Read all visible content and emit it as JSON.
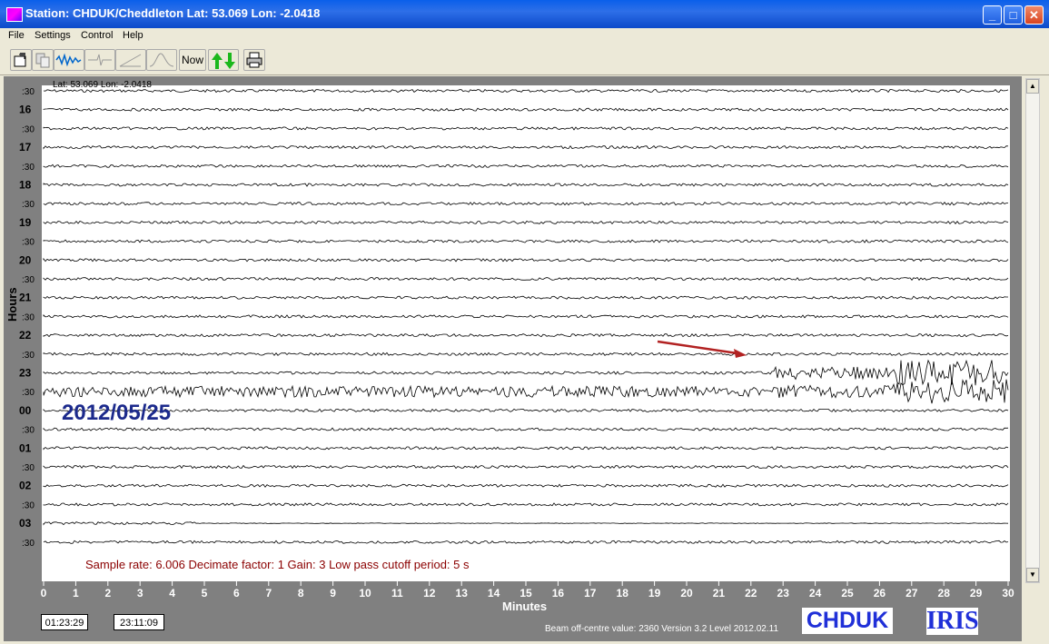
{
  "window": {
    "title": "Station: CHDUK/Cheddleton Lat: 53.069 Lon: -2.0418",
    "minimize_label": "_",
    "maximize_label": "□",
    "close_label": "✕"
  },
  "menu": {
    "file": "File",
    "settings": "Settings",
    "control": "Control",
    "help": "Help"
  },
  "toolbar": {
    "now_label": "Now",
    "icons": [
      "open-file-icon",
      "copy-icon",
      "waveform-icon",
      "filter-icon",
      "gain-icon",
      "spectrum-icon",
      "arrows-updown-icon",
      "print-icon"
    ]
  },
  "plot": {
    "header": "Lat: 53.069 Lon: -2.0418",
    "date_label": "2012/05/25",
    "info_line": "Sample rate: 6.006  Decimate factor: 1  Gain: 3  Low pass cutoff period: 5 s",
    "y_axis_title": "Hours",
    "x_axis_title": "Minutes",
    "row_labels": [
      "16",
      ":30",
      "17",
      ":30",
      "18",
      ":30",
      "19",
      ":30",
      "20",
      ":30",
      "21",
      ":30",
      "22",
      ":30",
      "23",
      ":30",
      "00",
      ":30",
      "01",
      ":30",
      "02",
      ":30",
      "03",
      ":30"
    ],
    "top_row_label": ":30",
    "x_ticks": [
      "0",
      "1",
      "2",
      "3",
      "4",
      "5",
      "6",
      "7",
      "8",
      "9",
      "10",
      "11",
      "12",
      "13",
      "14",
      "15",
      "16",
      "17",
      "18",
      "19",
      "20",
      "21",
      "22",
      "23",
      "24",
      "25",
      "26",
      "27",
      "28",
      "29",
      "30"
    ],
    "colors": {
      "plot_bg": "#FFFFFF",
      "trace": "#000000",
      "date": "#1C2A8C",
      "info": "#8B0000",
      "arrow": "#B22222"
    }
  },
  "status": {
    "time_left": "01:23:29",
    "time_right": "23:11:09",
    "beam_text": "Beam off-centre value: 2360 Version 3.2 Level 2012.02.11",
    "station_logo": "CHDUK",
    "iris_logo": "IRIS"
  }
}
